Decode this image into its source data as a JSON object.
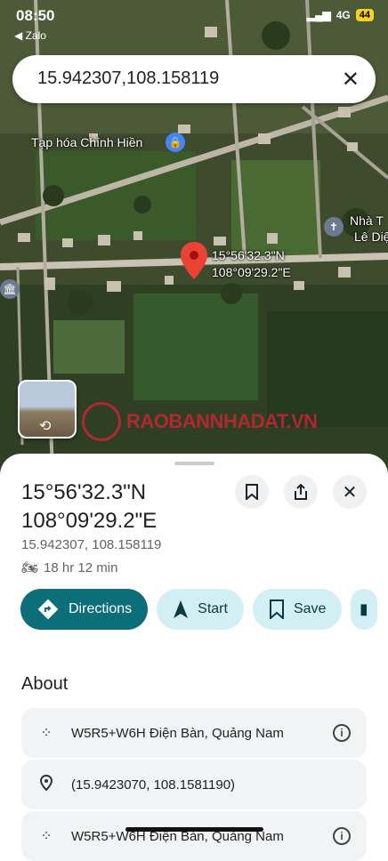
{
  "status_bar": {
    "time": "08:50",
    "back_label": "◀ Zalo",
    "network": "4G",
    "battery": "44"
  },
  "search": {
    "query": "15.942307,108.158119"
  },
  "map": {
    "labels": {
      "shop": "Tạp hóa Chính Hiền",
      "church_line1": "Nhà T",
      "church_line2": "Lê Diệ"
    },
    "pin_label_line1": "15°56'32.3\"N",
    "pin_label_line2": "108°09'29.2\"E",
    "watermark": "RAOBANNHADAT.VN"
  },
  "place": {
    "title_line1": "15°56'32.3\"N",
    "title_line2": "108°09'29.2\"E",
    "decimal_coords": "15.942307, 108.158119",
    "travel_time": "18 hr 12 min"
  },
  "actions": {
    "directions": "Directions",
    "start": "Start",
    "save": "Save"
  },
  "about": {
    "heading": "About",
    "rows": [
      {
        "text": "W5R5+W6H Điện Bàn, Quảng Nam"
      },
      {
        "text": "(15.9423070, 108.1581190)"
      },
      {
        "text": "W5R5+W6H Điện Bàn, Quảng Nam"
      }
    ]
  },
  "colors": {
    "primary": "#0b6e78",
    "secondary": "#d2f0f4",
    "pin": "#ea4335"
  }
}
